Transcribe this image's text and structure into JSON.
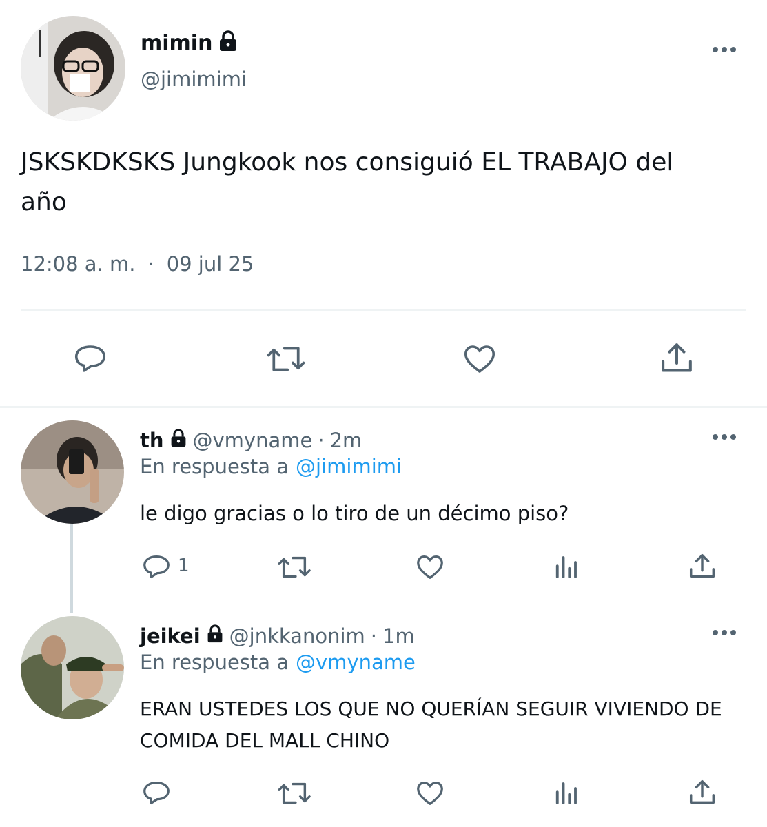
{
  "main_tweet": {
    "display_name": "mimin",
    "handle": "@jimimimi",
    "text_line1": "JSKSKDKSKS Jungkook nos consiguió EL TRABAJO del",
    "text_line2": "año",
    "time": "12:08 a. m.",
    "separator": "·",
    "date": "09 jul 25"
  },
  "replies": [
    {
      "display_name": "th",
      "handle": "@vmyname",
      "separator": "·",
      "time": "2m",
      "reply_prefix": "En respuesta a",
      "reply_to": "@jimimimi",
      "text_lines": [
        "le digo gracias o lo tiro de un décimo piso?"
      ],
      "reply_count": "1"
    },
    {
      "display_name": "jeikei",
      "handle": "@jnkkanonim",
      "separator": "·",
      "time": "1m",
      "reply_prefix": "En respuesta a",
      "reply_to": "@vmyname",
      "text_lines": [
        "ERAN USTEDES LOS QUE NO QUERÍAN SEGUIR VIVIENDO DE",
        "COMIDA DEL MALL CHINO"
      ],
      "reply_count": ""
    }
  ],
  "colors": {
    "text": "#0f1419",
    "muted": "#536471",
    "link": "#1d9bf0",
    "divider": "#eff3f4",
    "thread_line": "#cfd9de"
  },
  "icons": [
    "lock-icon",
    "more-options-icon",
    "reply-icon",
    "retweet-icon",
    "like-icon",
    "share-icon",
    "analytics-icon"
  ]
}
